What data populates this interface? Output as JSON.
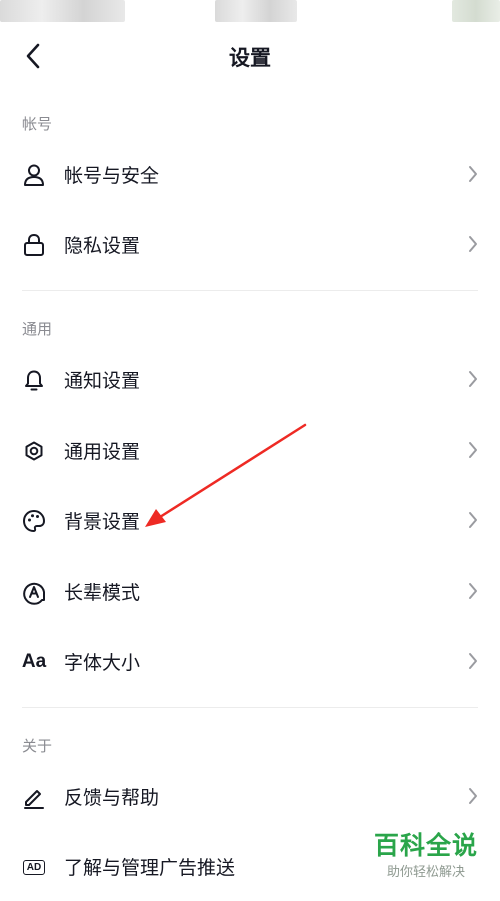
{
  "header": {
    "title": "设置"
  },
  "sections": [
    {
      "title": "帐号",
      "items": [
        {
          "label": "帐号与安全",
          "icon": "user-icon"
        },
        {
          "label": "隐私设置",
          "icon": "lock-icon"
        }
      ]
    },
    {
      "title": "通用",
      "items": [
        {
          "label": "通知设置",
          "icon": "bell-icon"
        },
        {
          "label": "通用设置",
          "icon": "gear-icon"
        },
        {
          "label": "背景设置",
          "icon": "palette-icon"
        },
        {
          "label": "长辈模式",
          "icon": "elder-mode-icon"
        },
        {
          "label": "字体大小",
          "icon": "font-size-icon",
          "icon_text": "Aa"
        }
      ]
    },
    {
      "title": "关于",
      "items": [
        {
          "label": "反馈与帮助",
          "icon": "pencil-icon"
        },
        {
          "label": "了解与管理广告推送",
          "icon": "ad-icon",
          "icon_text": "AD"
        }
      ]
    }
  ],
  "watermark": {
    "title": "百科全说",
    "subtitle": "助你轻松解决"
  },
  "colors": {
    "text": "#161823",
    "section": "#8a8b91",
    "chevron": "#9a9ba0",
    "arrow": "#ee2a24",
    "watermark": "#2aa54a"
  }
}
